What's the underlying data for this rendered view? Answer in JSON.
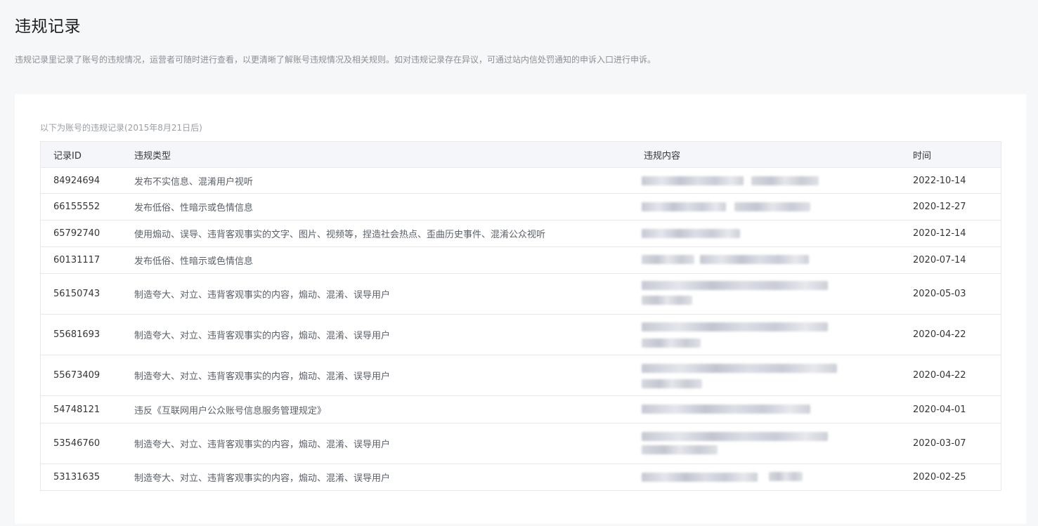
{
  "page": {
    "title": "违规记录",
    "description": "违规记录里记录了账号的违规情况，运营者可随时进行查看，以更清晰了解账号违规情况及相关规则。如对违规记录存在异议，可通过站内信处罚通知的申诉入口进行申诉。"
  },
  "records": {
    "subtitle": "以下为账号的违规记录(2015年8月21日后)",
    "headers": {
      "id": "记录ID",
      "type": "违规类型",
      "content": "违规内容",
      "time": "时间"
    },
    "rows": [
      {
        "id": "84924694",
        "type": "发布不实信息、混淆用户视听",
        "time": "2022-10-14"
      },
      {
        "id": "66155552",
        "type": "发布低俗、性暗示或色情信息",
        "time": "2020-12-27"
      },
      {
        "id": "65792740",
        "type": "使用煽动、误导、违背客观事实的文字、图片、视频等，捏造社会热点、歪曲历史事件、混淆公众视听",
        "time": "2020-12-14"
      },
      {
        "id": "60131117",
        "type": "发布低俗、性暗示或色情信息",
        "time": "2020-07-14"
      },
      {
        "id": "56150743",
        "type": "制造夸大、对立、违背客观事实的内容，煽动、混淆、误导用户",
        "time": "2020-05-03"
      },
      {
        "id": "55681693",
        "type": "制造夸大、对立、违背客观事实的内容，煽动、混淆、误导用户",
        "time": "2020-04-22"
      },
      {
        "id": "55673409",
        "type": "制造夸大、对立、违背客观事实的内容，煽动、混淆、误导用户",
        "time": "2020-04-22"
      },
      {
        "id": "54748121",
        "type": "违反《互联网用户公众账号信息服务管理规定》",
        "time": "2020-04-01"
      },
      {
        "id": "53546760",
        "type": "制造夸大、对立、违背客观事实的内容，煽动、混淆、误导用户",
        "time": "2020-03-07"
      },
      {
        "id": "53131635",
        "type": "制造夸大、对立、违背客观事实的内容，煽动、混淆、误导用户",
        "time": "2020-02-25"
      }
    ]
  }
}
